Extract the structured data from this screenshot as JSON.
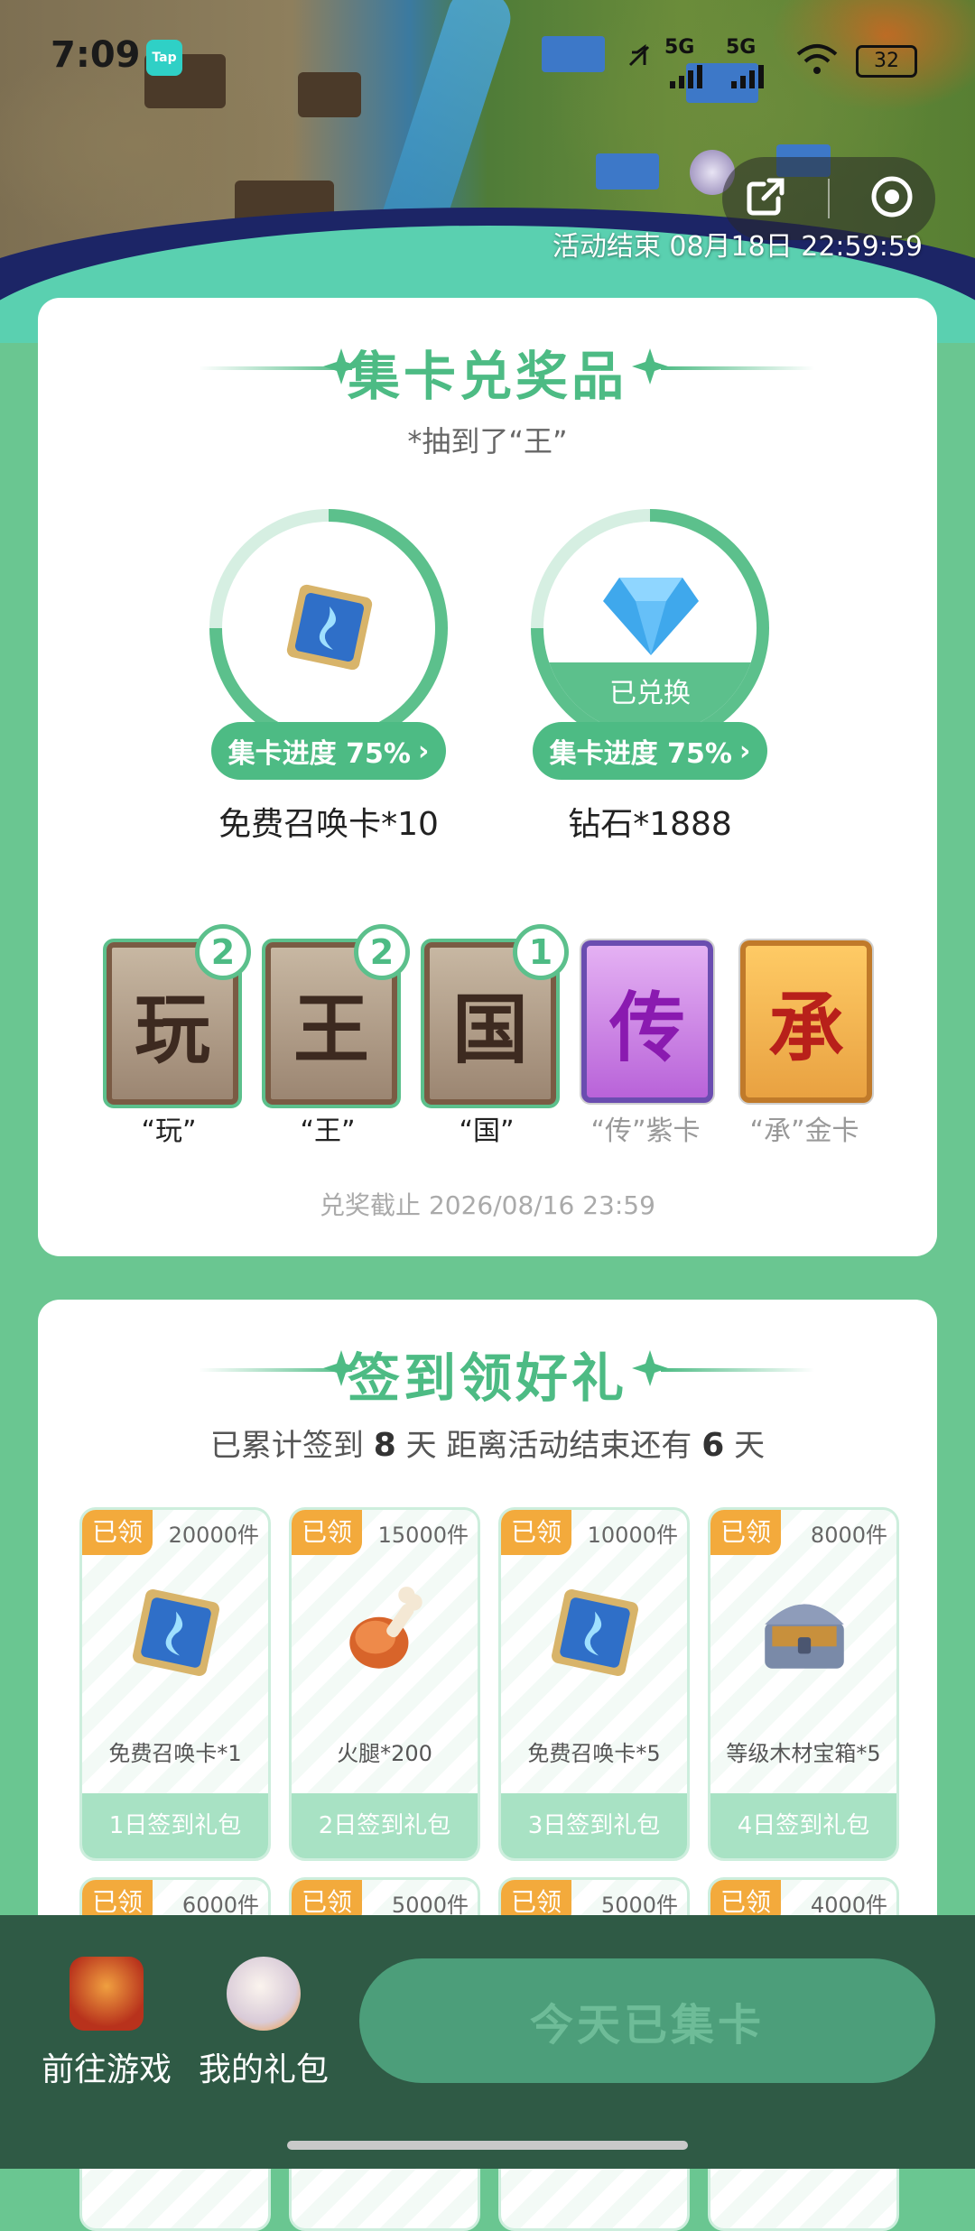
{
  "status_bar": {
    "time": "7:09",
    "app_badge": "Tap",
    "signal1": "5G",
    "signal2": "5G",
    "battery": "32"
  },
  "banner": {
    "activity_end": "活动结束 08月18日 22:59:59"
  },
  "collect_section": {
    "title": "集卡兑奖品",
    "subtitle": "*抽到了“王”",
    "prizes": [
      {
        "name": "免费召唤卡*10",
        "progress_label": "集卡进度 75%",
        "progress": 0.75,
        "redeemed": ""
      },
      {
        "name": "钻石*1888",
        "progress_label": "集卡进度 75%",
        "progress": 0.75,
        "redeemed": "已兑换"
      }
    ],
    "cards": [
      {
        "char": "玩",
        "label": "“玩”",
        "count": "2"
      },
      {
        "char": "王",
        "label": "“王”",
        "count": "2"
      },
      {
        "char": "国",
        "label": "“国”",
        "count": "1"
      },
      {
        "char": "传",
        "label": "“传”紫卡",
        "count": ""
      },
      {
        "char": "承",
        "label": "“承”金卡",
        "count": ""
      }
    ],
    "deadline": "兑奖截止 2026/08/16 23:59"
  },
  "checkin_section": {
    "title": "签到领好礼",
    "summary_prefix": "已累计签到",
    "days_signed": "8",
    "summary_mid": "天  距离活动结束还有",
    "days_left": "6",
    "summary_suffix": "天",
    "gifts": [
      {
        "claimed": "已领",
        "stock": "20000件",
        "name": "免费召唤卡*1",
        "day": "1日签到礼包"
      },
      {
        "claimed": "已领",
        "stock": "15000件",
        "name": "火腿*200",
        "day": "2日签到礼包"
      },
      {
        "claimed": "已领",
        "stock": "10000件",
        "name": "免费召唤卡*5",
        "day": "3日签到礼包"
      },
      {
        "claimed": "已领",
        "stock": "8000件",
        "name": "等级木材宝箱*5",
        "day": "4日签到礼包"
      },
      {
        "claimed": "已领",
        "stock": "6000件"
      },
      {
        "claimed": "已领",
        "stock": "5000件"
      },
      {
        "claimed": "已领",
        "stock": "5000件"
      },
      {
        "claimed": "已领",
        "stock": "4000件"
      }
    ]
  },
  "bottom_bar": {
    "go_game": "前往游戏",
    "my_gifts": "我的礼包",
    "collect_button": "今天已集卡"
  },
  "colors": {
    "accent": "#4dbb84",
    "claimed": "#f3aa3c",
    "bottom_bar": "#2f5a45"
  }
}
